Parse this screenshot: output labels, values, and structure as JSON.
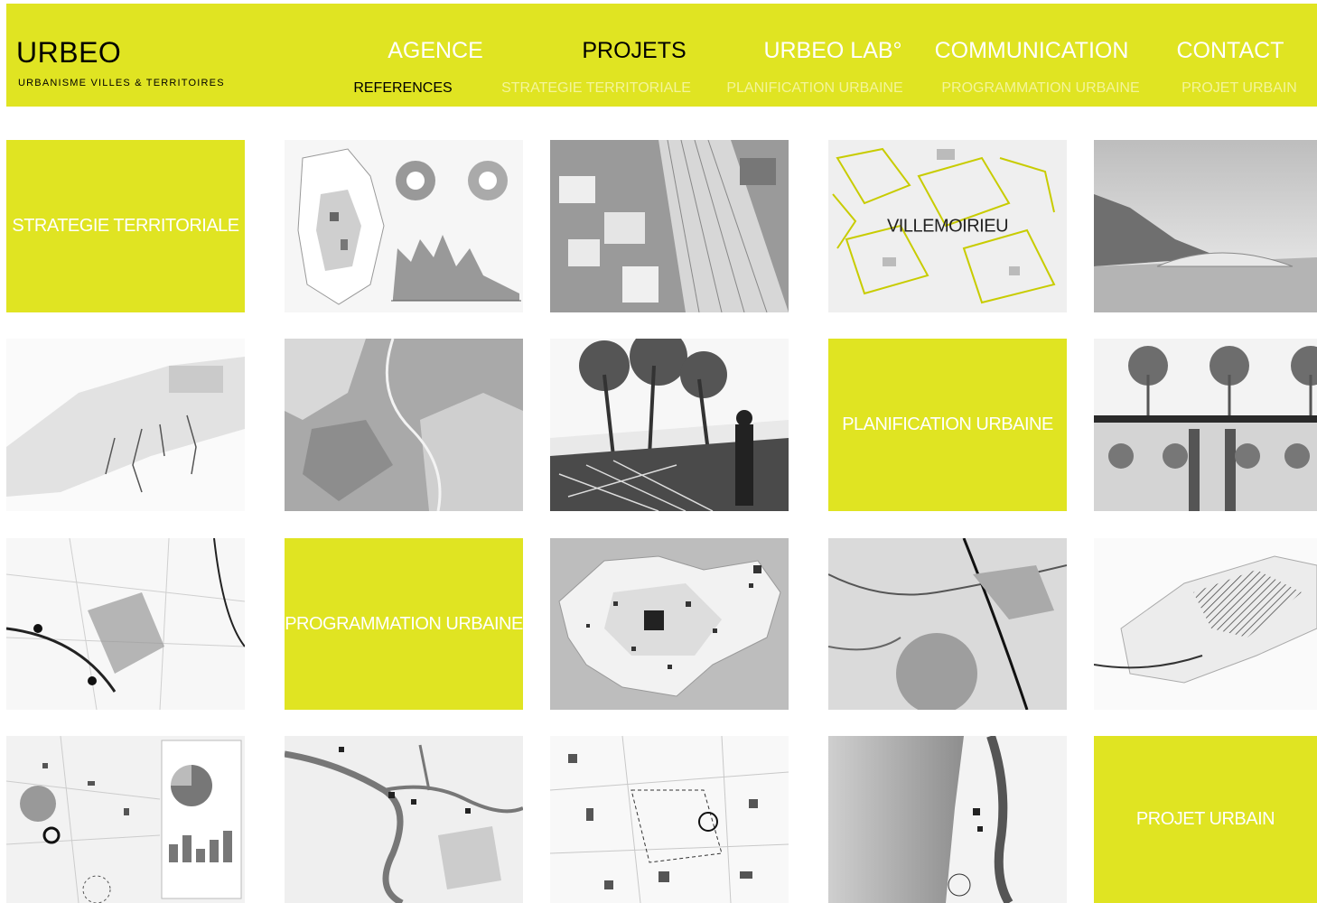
{
  "brand": {
    "name": "URBEO",
    "tagline": "URBANISME  VILLES & TERRITOIRES"
  },
  "nav": {
    "main": [
      "AGENCE",
      "PROJETS",
      "URBEO LAB°",
      "COMMUNICATION",
      "CONTACT"
    ],
    "active_main": "PROJETS",
    "sub": [
      "REFERENCES",
      "STRATEGIE TERRITORIALE",
      "PLANIFICATION URBAINE",
      "PROGRAMMATION URBAINE",
      "PROJET URBAIN"
    ],
    "active_sub": "REFERENCES"
  },
  "tiles": {
    "strategie": "STRATEGIE TERRITORIALE",
    "planification": "PLANIFICATION URBAINE",
    "programmation": "PROGRAMMATION URBAINE",
    "projet": "PROJET URBAIN",
    "villemoirieu": "VILLEMOIRIEU"
  },
  "colors": {
    "accent": "#e0e422",
    "nav_inactive_main": "#ffffff",
    "nav_inactive_sub": "#f4f59a",
    "active": "#000000"
  }
}
